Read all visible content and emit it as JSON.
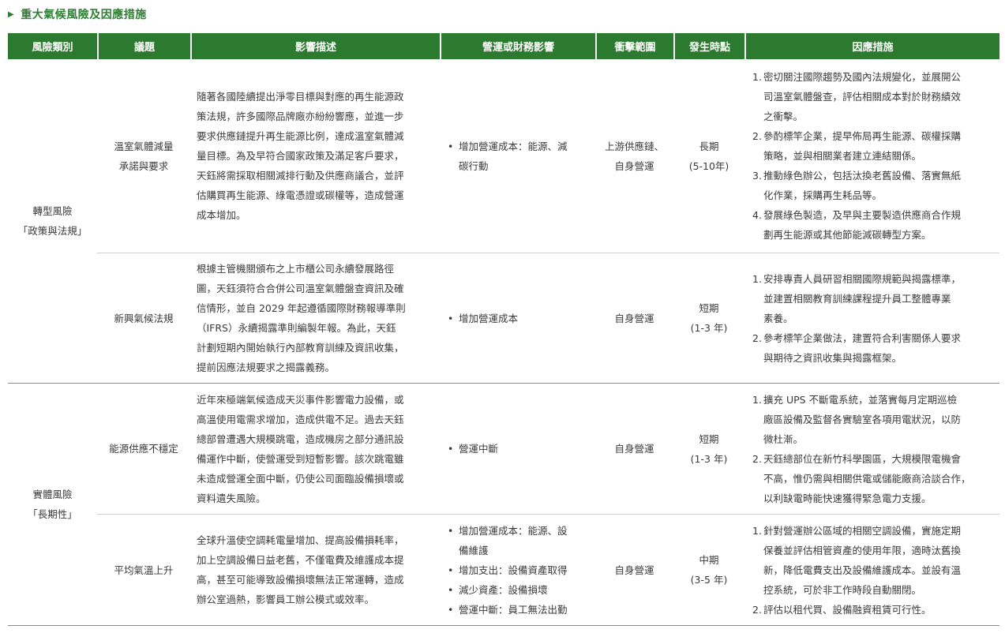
{
  "section": {
    "title": "重大氣候風險及因應措施"
  },
  "headers": [
    "風險類別",
    "議題",
    "影響描述",
    "營運或財務影響",
    "衝擊範圍",
    "發生時點",
    "因應措施"
  ],
  "categories": [
    {
      "line1": "轉型風險",
      "line2": "「政策與法規」"
    },
    {
      "line1": "實體風險",
      "line2": "「長期性」"
    }
  ],
  "rows": [
    {
      "issue_lines": [
        "溫室氣體減量",
        "承諾與要求"
      ],
      "desc_lines": [
        "隨著各國陸續提出淨零目標與對應的再生能源政",
        "策法規，許多國際品牌廠亦紛紛響應，並進一步",
        "要求供應鏈提升再生能源比例，達成溫室氣體減",
        "量目標。為及早符合國家政策及滿足客戶要求，",
        "天鈺將需採取相關減排行動及供應商議合，並評",
        "估購買再生能源、綠電憑證或碳權等，造成營運",
        "成本增加。"
      ],
      "impacts": [
        {
          "lines": [
            "增加營運成本：能源、減",
            "碳行動"
          ]
        }
      ],
      "scope_lines": [
        "上游供應鏈、",
        "自身營運"
      ],
      "time_lines": [
        "長期",
        "(5-10年)"
      ],
      "measures": [
        {
          "num": "1.",
          "lines": [
            "密切關注國際趨勢及國內法規變化，並展開公",
            "司溫室氣體盤查，評估相關成本對於財務績效",
            "之衝擊。"
          ]
        },
        {
          "num": "2.",
          "lines": [
            "參酌標竿企業，提早佈局再生能源、碳權採購",
            "策略，並與相關業者建立連結關係。"
          ]
        },
        {
          "num": "3.",
          "lines": [
            "推動綠色辦公，包括汰換老舊設備、落實無紙",
            "化作業，採購再生耗品等。"
          ]
        },
        {
          "num": "4.",
          "lines": [
            "發展綠色製造，及早與主要製造供應商合作規",
            "劃再生能源或其他節能減碳轉型方案。"
          ]
        }
      ]
    },
    {
      "issue_lines": [
        "新興氣候法規"
      ],
      "desc_lines": [
        "根據主管機關頒布之上市櫃公司永續發展路徑",
        "圖，天鈺須符合合併公司溫室氣體盤查資訊及確",
        "信情形，並自 2029 年起遵循國際財務報導準則",
        "（IFRS）永續揭露準則編製年報。為此，天鈺",
        "計劃短期內開始執行內部教育訓練及資訊收集，",
        "提前因應法規要求之揭露義務。"
      ],
      "impacts": [
        {
          "lines": [
            "增加營運成本"
          ]
        }
      ],
      "scope_lines": [
        "自身營運"
      ],
      "time_lines": [
        "短期",
        "(1-3 年)"
      ],
      "measures": [
        {
          "num": "1.",
          "lines": [
            "安排專責人員研習相關國際規範與揭露標準，",
            "並建置相關教育訓練課程提升員工整體專業",
            "素養。"
          ]
        },
        {
          "num": "2.",
          "lines": [
            "參考標竿企業做法，建置符合利害關係人要求",
            "與期待之資訊收集與揭露框架。"
          ]
        }
      ]
    },
    {
      "issue_lines": [
        "能源供應不穩定"
      ],
      "desc_lines": [
        "近年來極端氣候造成天災事件影響電力設備，或",
        "高溫使用電需求增加，造成供電不足。過去天鈺",
        "總部曾遭遇大規模跳電，造成機房之部分通訊設",
        "備運作中斷，使營運受到短暫影響。該次跳電雖",
        "未造成營運全面中斷，仍使公司面臨設備損壞或",
        "資料遺失風險。"
      ],
      "impacts": [
        {
          "lines": [
            "營運中斷"
          ]
        }
      ],
      "scope_lines": [
        "自身營運"
      ],
      "time_lines": [
        "短期",
        "(1-3 年)"
      ],
      "measures": [
        {
          "num": "1.",
          "lines": [
            "擴充 UPS 不斷電系統，並落實每月定期巡檢",
            "廠區設備及監督各實驗室各項用電狀況，以防",
            "微杜漸。"
          ]
        },
        {
          "num": "2.",
          "lines": [
            "天鈺總部位在新竹科學園區，大規模限電機會",
            "不高，惟仍需與相關供電或儲能廠商洽談合作，",
            "以利缺電時能快速獲得緊急電力支援。"
          ]
        }
      ]
    },
    {
      "issue_lines": [
        "平均氣溫上升"
      ],
      "desc_lines": [
        "全球升溫使空調耗電量增加、提高設備損耗率，",
        "加上空調設備日益老舊，不僅電費及維護成本提",
        "高，甚至可能導致設備損壞無法正常運轉，造成",
        "辦公室過熱，影響員工辦公模式或效率。"
      ],
      "impacts": [
        {
          "lines": [
            "增加營運成本：能源、設",
            "備維護"
          ]
        },
        {
          "lines": [
            "增加支出：設備資產取得"
          ]
        },
        {
          "lines": [
            "減少資產：設備損壞"
          ]
        },
        {
          "lines": [
            "營運中斷：員工無法出勤"
          ]
        }
      ],
      "scope_lines": [
        "自身營運"
      ],
      "time_lines": [
        "中期",
        "(3-5 年)"
      ],
      "measures": [
        {
          "num": "1.",
          "lines": [
            "針對營運辦公區域的相關空調設備，實施定期",
            "保養並評估相管資產的使用年限，適時汰舊換",
            "新，降低電費支出及設備維護成本。並設有溫",
            "控系統，可於非工作時段自動關閉。"
          ]
        },
        {
          "num": "2.",
          "lines": [
            "評估以租代買、設備融資租賃可行性。"
          ]
        }
      ]
    }
  ]
}
